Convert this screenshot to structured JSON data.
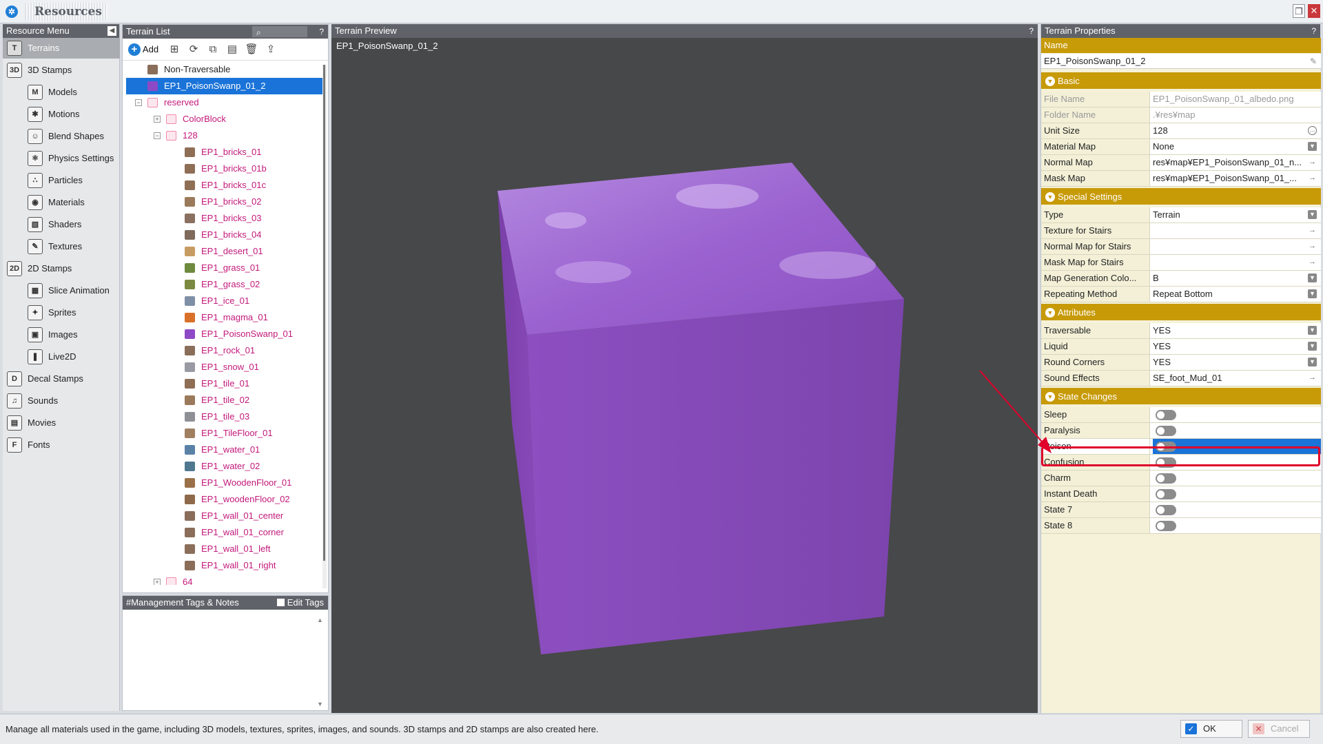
{
  "window": {
    "title": "Resources"
  },
  "resource_menu": {
    "title": "Resource Menu",
    "items": [
      {
        "label": "Terrains",
        "icon": "T",
        "indent": 0,
        "active": true
      },
      {
        "label": "3D Stamps",
        "icon": "3D",
        "indent": 0,
        "active": false
      },
      {
        "label": "Models",
        "icon": "M",
        "indent": 1,
        "active": false
      },
      {
        "label": "Motions",
        "icon": "✱",
        "indent": 1,
        "active": false
      },
      {
        "label": "Blend Shapes",
        "icon": "☺",
        "indent": 1,
        "active": false
      },
      {
        "label": "Physics Settings",
        "icon": "⚛",
        "indent": 1,
        "active": false
      },
      {
        "label": "Particles",
        "icon": "∴",
        "indent": 1,
        "active": false
      },
      {
        "label": "Materials",
        "icon": "◉",
        "indent": 1,
        "active": false
      },
      {
        "label": "Shaders",
        "icon": "▧",
        "indent": 1,
        "active": false
      },
      {
        "label": "Textures",
        "icon": "✎",
        "indent": 1,
        "active": false
      },
      {
        "label": "2D Stamps",
        "icon": "2D",
        "indent": 0,
        "active": false
      },
      {
        "label": "Slice Animation",
        "icon": "▦",
        "indent": 1,
        "active": false
      },
      {
        "label": "Sprites",
        "icon": "✦",
        "indent": 1,
        "active": false
      },
      {
        "label": "Images",
        "icon": "▣",
        "indent": 1,
        "active": false
      },
      {
        "label": "Live2D",
        "icon": "❚",
        "indent": 1,
        "active": false
      },
      {
        "label": "Decal Stamps",
        "icon": "D",
        "indent": 0,
        "active": false
      },
      {
        "label": "Sounds",
        "icon": "♫",
        "indent": 0,
        "active": false
      },
      {
        "label": "Movies",
        "icon": "▤",
        "indent": 0,
        "active": false
      },
      {
        "label": "Fonts",
        "icon": "F",
        "indent": 0,
        "active": false
      }
    ]
  },
  "terrain_list": {
    "title": "Terrain List",
    "help": "?",
    "toolbar": {
      "add_label": "Add"
    },
    "items": [
      {
        "label": "Non-Traversable",
        "type": "terrain",
        "color": "#8a6e5a",
        "depth": 0,
        "selected": false,
        "black": true
      },
      {
        "label": "EP1_PoisonSwanp_01_2",
        "type": "terrain",
        "color": "#8e4ac6",
        "depth": 0,
        "selected": true,
        "black": false
      },
      {
        "label": "reserved",
        "type": "folder",
        "depth": 0,
        "expander": "−",
        "selected": false,
        "black": false
      },
      {
        "label": "ColorBlock",
        "type": "folder",
        "depth": 1,
        "expander": "+",
        "selected": false,
        "black": false
      },
      {
        "label": "128",
        "type": "folder",
        "depth": 1,
        "expander": "−",
        "selected": false,
        "black": false
      },
      {
        "label": "EP1_bricks_01",
        "type": "terrain",
        "color": "#8f6e56",
        "depth": 2
      },
      {
        "label": "EP1_bricks_01b",
        "type": "terrain",
        "color": "#8f6e56",
        "depth": 2
      },
      {
        "label": "EP1_bricks_01c",
        "type": "terrain",
        "color": "#8f6e56",
        "depth": 2
      },
      {
        "label": "EP1_bricks_02",
        "type": "terrain",
        "color": "#9a7a5a",
        "depth": 2
      },
      {
        "label": "EP1_bricks_03",
        "type": "terrain",
        "color": "#8a7060",
        "depth": 2
      },
      {
        "label": "EP1_bricks_04",
        "type": "terrain",
        "color": "#7f6a5c",
        "depth": 2
      },
      {
        "label": "EP1_desert_01",
        "type": "terrain",
        "color": "#c79c62",
        "depth": 2
      },
      {
        "label": "EP1_grass_01",
        "type": "terrain",
        "color": "#6e8a3e",
        "depth": 2
      },
      {
        "label": "EP1_grass_02",
        "type": "terrain",
        "color": "#7a8a40",
        "depth": 2
      },
      {
        "label": "EP1_ice_01",
        "type": "terrain",
        "color": "#7f8fa6",
        "depth": 2
      },
      {
        "label": "EP1_magma_01",
        "type": "terrain",
        "color": "#d9702a",
        "depth": 2
      },
      {
        "label": "EP1_PoisonSwanp_01",
        "type": "terrain",
        "color": "#8e4ac6",
        "depth": 2
      },
      {
        "label": "EP1_rock_01",
        "type": "terrain",
        "color": "#8a6e5a",
        "depth": 2
      },
      {
        "label": "EP1_snow_01",
        "type": "terrain",
        "color": "#9a9aa4",
        "depth": 2
      },
      {
        "label": "EP1_tile_01",
        "type": "terrain",
        "color": "#8f6e56",
        "depth": 2
      },
      {
        "label": "EP1_tile_02",
        "type": "terrain",
        "color": "#9a7a5a",
        "depth": 2
      },
      {
        "label": "EP1_tile_03",
        "type": "terrain",
        "color": "#8f8f96",
        "depth": 2
      },
      {
        "label": "EP1_TileFloor_01",
        "type": "terrain",
        "color": "#a08060",
        "depth": 2
      },
      {
        "label": "EP1_water_01",
        "type": "terrain",
        "color": "#5a82a6",
        "depth": 2
      },
      {
        "label": "EP1_water_02",
        "type": "terrain",
        "color": "#4e7890",
        "depth": 2
      },
      {
        "label": "EP1_WoodenFloor_01",
        "type": "terrain",
        "color": "#9a7048",
        "depth": 2
      },
      {
        "label": "EP1_woodenFloor_02",
        "type": "terrain",
        "color": "#8e6a4a",
        "depth": 2
      },
      {
        "label": "EP1_wall_01_center",
        "type": "terrain",
        "color": "#8a6e5a",
        "depth": 2
      },
      {
        "label": "EP1_wall_01_corner",
        "type": "terrain",
        "color": "#8a6e5a",
        "depth": 2
      },
      {
        "label": "EP1_wall_01_left",
        "type": "terrain",
        "color": "#8a6e5a",
        "depth": 2
      },
      {
        "label": "EP1_wall_01_right",
        "type": "terrain",
        "color": "#8a6e5a",
        "depth": 2
      },
      {
        "label": "64",
        "type": "folder",
        "depth": 1,
        "expander": "+",
        "selected": false,
        "black": false
      }
    ]
  },
  "tags_panel": {
    "title": "#Management Tags & Notes",
    "edit_tags_label": "Edit Tags"
  },
  "preview": {
    "title": "Terrain Preview",
    "help": "?",
    "name": "EP1_PoisonSwanp_01_2",
    "cube_color": "#9a5bc7"
  },
  "properties": {
    "title": "Terrain Properties",
    "help": "?",
    "name_label": "Name",
    "name_value": "EP1_PoisonSwanp_01_2",
    "sections": [
      {
        "title": "Basic",
        "rows": [
          {
            "label": "File Name",
            "value": "EP1_PoisonSwanp_01_albedo.png",
            "readonly": true,
            "ctrl": ""
          },
          {
            "label": "Folder Name",
            "value": ".¥res¥map",
            "readonly": true,
            "ctrl": ""
          },
          {
            "label": "Unit Size",
            "value": "128",
            "ctrl": "round"
          },
          {
            "label": "Material Map",
            "value": "None",
            "ctrl": "box"
          },
          {
            "label": "Normal Map",
            "value": "res¥map¥EP1_PoisonSwanp_01_n...",
            "ctrl": "arrow"
          },
          {
            "label": "Mask Map",
            "value": "res¥map¥EP1_PoisonSwanp_01_...",
            "ctrl": "arrow"
          }
        ]
      },
      {
        "title": "Special Settings",
        "rows": [
          {
            "label": "Type",
            "value": "Terrain",
            "ctrl": "box"
          },
          {
            "label": "Texture for Stairs",
            "value": "",
            "ctrl": "arrow"
          },
          {
            "label": "Normal Map for Stairs",
            "value": "",
            "ctrl": "arrow"
          },
          {
            "label": "Mask Map for Stairs",
            "value": "",
            "ctrl": "arrow"
          },
          {
            "label": "Map Generation Colo...",
            "value": "B",
            "ctrl": "box"
          },
          {
            "label": "Repeating Method",
            "value": "Repeat Bottom",
            "ctrl": "box"
          }
        ]
      },
      {
        "title": "Attributes",
        "rows": [
          {
            "label": "Traversable",
            "value": "YES",
            "ctrl": "box"
          },
          {
            "label": "Liquid",
            "value": "YES",
            "ctrl": "box"
          },
          {
            "label": "Round Corners",
            "value": "YES",
            "ctrl": "box"
          },
          {
            "label": "Sound Effects",
            "value": "SE_foot_Mud_01",
            "ctrl": "arrow"
          }
        ]
      },
      {
        "title": "State Changes",
        "rows": [
          {
            "label": "Sleep",
            "toggle": true,
            "on": false
          },
          {
            "label": "Paralysis",
            "toggle": true,
            "on": false
          },
          {
            "label": "Poison",
            "toggle": true,
            "on": false,
            "highlight": true
          },
          {
            "label": "Confusion",
            "toggle": true,
            "on": false
          },
          {
            "label": "Charm",
            "toggle": true,
            "on": false
          },
          {
            "label": "Instant Death",
            "toggle": true,
            "on": false
          },
          {
            "label": "State 7",
            "toggle": true,
            "on": false
          },
          {
            "label": "State 8",
            "toggle": true,
            "on": false
          }
        ]
      }
    ]
  },
  "statusbar": {
    "message": "Manage all materials used in the game, including 3D models, textures, sprites, images, and sounds. 3D stamps and 2D stamps are also created here.",
    "ok_label": "OK",
    "cancel_label": "Cancel"
  },
  "colors": {
    "accent": "#1a73d8",
    "section": "#c79a08",
    "annotation": "#e0002a"
  }
}
